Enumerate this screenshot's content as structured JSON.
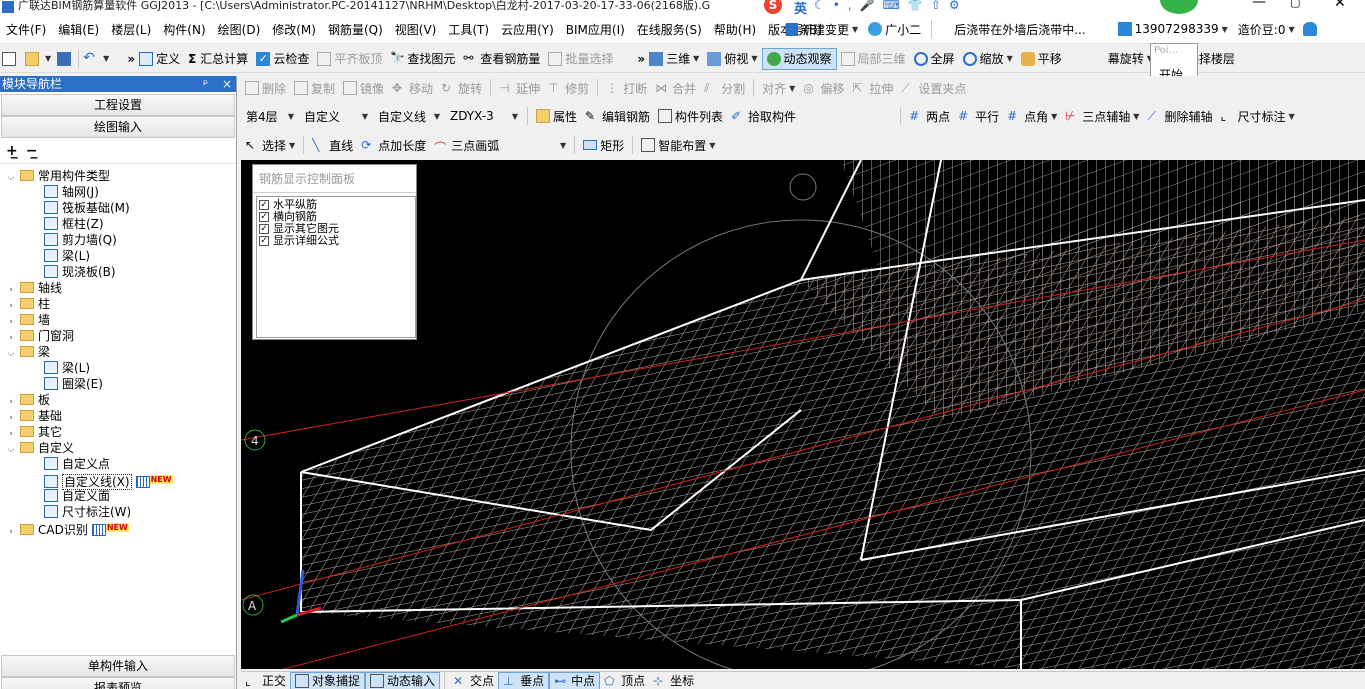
{
  "titlebar": {
    "text": "广联达BIM钢筋算量软件 GGJ2013 - [C:\\Users\\Administrator.PC-20141127\\NRHM\\Desktop\\白龙村-2017-03-20-17-33-06(2168版).G"
  },
  "menu": [
    "文件(F)",
    "编辑(E)",
    "楼层(L)",
    "构件(N)",
    "绘图(D)",
    "修改(M)",
    "钢筋量(Q)",
    "视图(V)",
    "工具(T)",
    "云应用(Y)",
    "BIM应用(I)",
    "在线服务(S)",
    "帮助(H)",
    "版本号(B)"
  ],
  "menu_right": {
    "new_change": "新建变更",
    "guangxiaoer": "广小二",
    "notice": "后浇带在外墙后浇带中...",
    "phone": "13907298339",
    "cost_bean": "造价豆:0",
    "ime_label": "英"
  },
  "toolbar1": {
    "define": "定义",
    "sum_calc": "汇总计算",
    "cloud_check": "云检查",
    "flush_slab": "平齐板顶",
    "find_element": "查找图元",
    "view_rebar": "查看钢筋量",
    "batch_select": "批量选择",
    "three_d": "三维",
    "top_view": "俯视",
    "dynamic_view": "动态观察",
    "local_3d": "局部三维",
    "fullscreen": "全屏",
    "zoom": "缩放",
    "pan": "平移",
    "rotate": "幕旋转",
    "select_floor": "选择楼层"
  },
  "popup": {
    "title": "Poi...",
    "start": "开始"
  },
  "left_panel": {
    "title": "模块导航栏",
    "pin": "ᵖ",
    "close": "×",
    "project_settings": "工程设置",
    "drawing_input": "绘图输入",
    "single_input": "单构件输入",
    "report_preview": "报表预览",
    "tree": [
      {
        "label": "常用构件类型",
        "level": 0,
        "type": "folder",
        "open": true
      },
      {
        "label": "轴网(J)",
        "level": 1,
        "type": "leaf"
      },
      {
        "label": "筏板基础(M)",
        "level": 1,
        "type": "leaf"
      },
      {
        "label": "框柱(Z)",
        "level": 1,
        "type": "leaf"
      },
      {
        "label": "剪力墙(Q)",
        "level": 1,
        "type": "leaf"
      },
      {
        "label": "梁(L)",
        "level": 1,
        "type": "leaf"
      },
      {
        "label": "现浇板(B)",
        "level": 1,
        "type": "leaf"
      },
      {
        "label": "轴线",
        "level": 0,
        "type": "folder",
        "open": false
      },
      {
        "label": "柱",
        "level": 0,
        "type": "folder",
        "open": false
      },
      {
        "label": "墙",
        "level": 0,
        "type": "folder",
        "open": false
      },
      {
        "label": "门窗洞",
        "level": 0,
        "type": "folder",
        "open": false
      },
      {
        "label": "梁",
        "level": 0,
        "type": "folder",
        "open": true
      },
      {
        "label": "梁(L)",
        "level": 1,
        "type": "leaf"
      },
      {
        "label": "圈梁(E)",
        "level": 1,
        "type": "leaf"
      },
      {
        "label": "板",
        "level": 0,
        "type": "folder",
        "open": false
      },
      {
        "label": "基础",
        "level": 0,
        "type": "folder",
        "open": false
      },
      {
        "label": "其它",
        "level": 0,
        "type": "folder",
        "open": false
      },
      {
        "label": "自定义",
        "level": 0,
        "type": "folder",
        "open": true
      },
      {
        "label": "自定义点",
        "level": 1,
        "type": "leaf"
      },
      {
        "label": "自定义线(X)",
        "level": 1,
        "type": "leaf",
        "selected": true,
        "badge": "NEW"
      },
      {
        "label": "自定义面",
        "level": 1,
        "type": "leaf"
      },
      {
        "label": "尺寸标注(W)",
        "level": 1,
        "type": "leaf"
      },
      {
        "label": "CAD识别",
        "level": 0,
        "type": "folder",
        "open": false,
        "badge": "NEW"
      }
    ]
  },
  "toolbar2": {
    "delete": "删除",
    "copy": "复制",
    "mirror": "镜像",
    "move": "移动",
    "rotate": "旋转",
    "extend": "延伸",
    "trim": "修剪",
    "break": "打断",
    "merge": "合并",
    "split": "分割",
    "align": "对齐",
    "offset": "偏移",
    "stretch": "拉伸",
    "set_grip": "设置夹点"
  },
  "toolbar3": {
    "floor": "第4层",
    "category": "自定义",
    "type": "自定义线",
    "element": "ZDYX-3",
    "properties": "属性",
    "edit_rebar": "编辑钢筋",
    "element_list": "构件列表",
    "pick_element": "拾取构件",
    "two_points": "两点",
    "parallel": "平行",
    "point_angle": "点角",
    "three_point_axis": "三点辅轴",
    "delete_axis": "删除辅轴",
    "dimension": "尺寸标注"
  },
  "toolbar4": {
    "select": "选择",
    "line": "直线",
    "point_length": "点加长度",
    "three_point_arc": "三点画弧",
    "rectangle": "矩形",
    "smart_layout": "智能布置"
  },
  "control_panel": {
    "title": "钢筋显示控制面板",
    "options": [
      {
        "label": "水平纵筋",
        "checked": true
      },
      {
        "label": "横向钢筋",
        "checked": true
      },
      {
        "label": "显示其它图元",
        "checked": true
      },
      {
        "label": "显示详细公式",
        "checked": true
      }
    ]
  },
  "viewport": {
    "axis_label_4": "4",
    "axis_label_a": "A"
  },
  "statusbar": {
    "ortho": "正交",
    "snap": "对象捕捉",
    "dynamic_input": "动态输入",
    "intersection": "交点",
    "perpendicular": "垂点",
    "midpoint": "中点",
    "vertex": "顶点",
    "coordinate": "坐标"
  },
  "colors": {
    "accent": "#2b6fc8",
    "rebar": "#b5a79f",
    "background": "#000000"
  }
}
